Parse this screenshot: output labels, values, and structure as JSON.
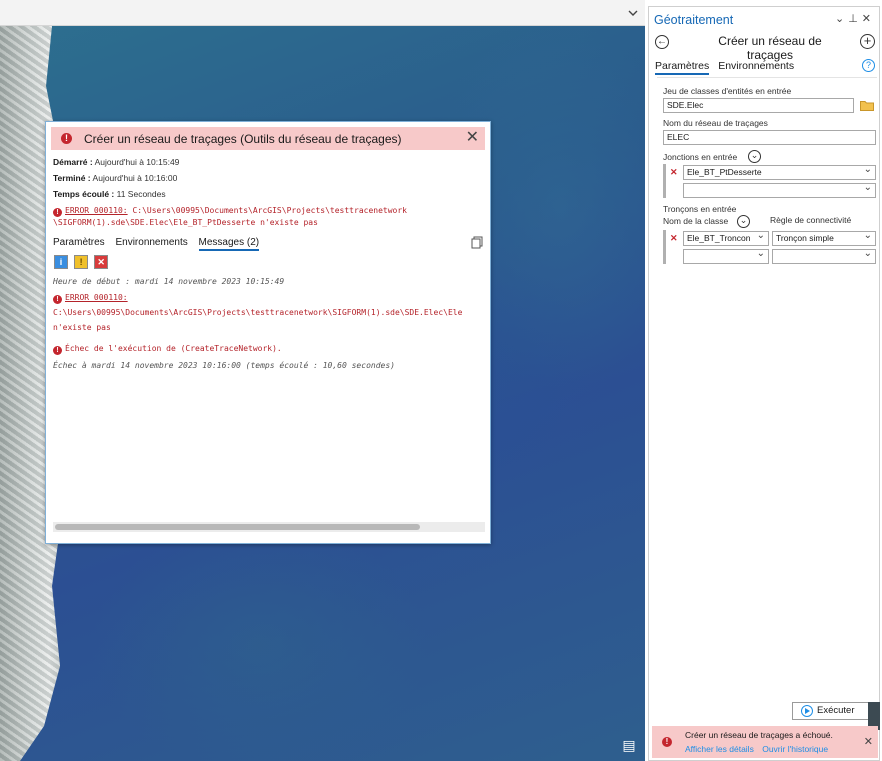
{
  "popup": {
    "title": "Créer un réseau de traçages (Outils du réseau de traçages)",
    "started_label": "Démarré :",
    "started_value": "Aujourd'hui à 10:15:49",
    "finished_label": "Terminé :",
    "finished_value": "Aujourd'hui à 10:16:00",
    "elapsed_label": "Temps écoulé :",
    "elapsed_value": "11 Secondes",
    "error_code": "ERROR 000110:",
    "error_line1": " C:\\Users\\00995\\Documents\\ArcGIS\\Projects\\testtracenetwork",
    "error_line2": "\\SIGFORM(1).sde\\SDE.Elec\\Ele_BT_PtDesserte n'existe pas",
    "tabs": [
      "Paramètres",
      "Environnements",
      "Messages (2)"
    ],
    "messages": {
      "start": "Heure de début : mardi 14 novembre 2023 10:15:49",
      "err_code": "ERROR 000110:",
      "err_path": "C:\\Users\\00995\\Documents\\ArcGIS\\Projects\\testtracenetwork\\SIGFORM(1).sde\\SDE.Elec\\Ele",
      "err_tail": "n'existe pas",
      "fail": "Échec de l'exécution de (CreateTraceNetwork).",
      "end": "Échec à mardi 14 novembre 2023 10:16:00 (temps écoulé : 10,60 secondes)"
    }
  },
  "pane": {
    "title": "Géotraitement",
    "tool_name": "Créer un réseau de traçages",
    "tabs": [
      "Paramètres",
      "Environnements"
    ],
    "fields": {
      "input_label": "Jeu de classes d'entités en entrée",
      "input_value": "SDE.Elec",
      "network_label": "Nom du réseau de traçages",
      "network_value": "ELEC",
      "junctions_label": "Jonctions en entrée",
      "junction_value": "Ele_BT_PtDesserte",
      "edges_label": "Tronçons en entrée",
      "class_col": "Nom de la classe",
      "rule_col": "Règle de connectivité",
      "edge_class_value": "Ele_BT_Troncon",
      "edge_rule_value": "Tronçon simple"
    },
    "run_label": "Exécuter",
    "status_text": "Créer un réseau de traçages a échoué.",
    "status_link1": "Afficher les détails",
    "status_link2": "Ouvrir l'historique"
  },
  "colors": {
    "accent": "#1668b5",
    "error": "#c4262e",
    "error_bg": "#f7c9c9",
    "link": "#1e8ee6"
  }
}
